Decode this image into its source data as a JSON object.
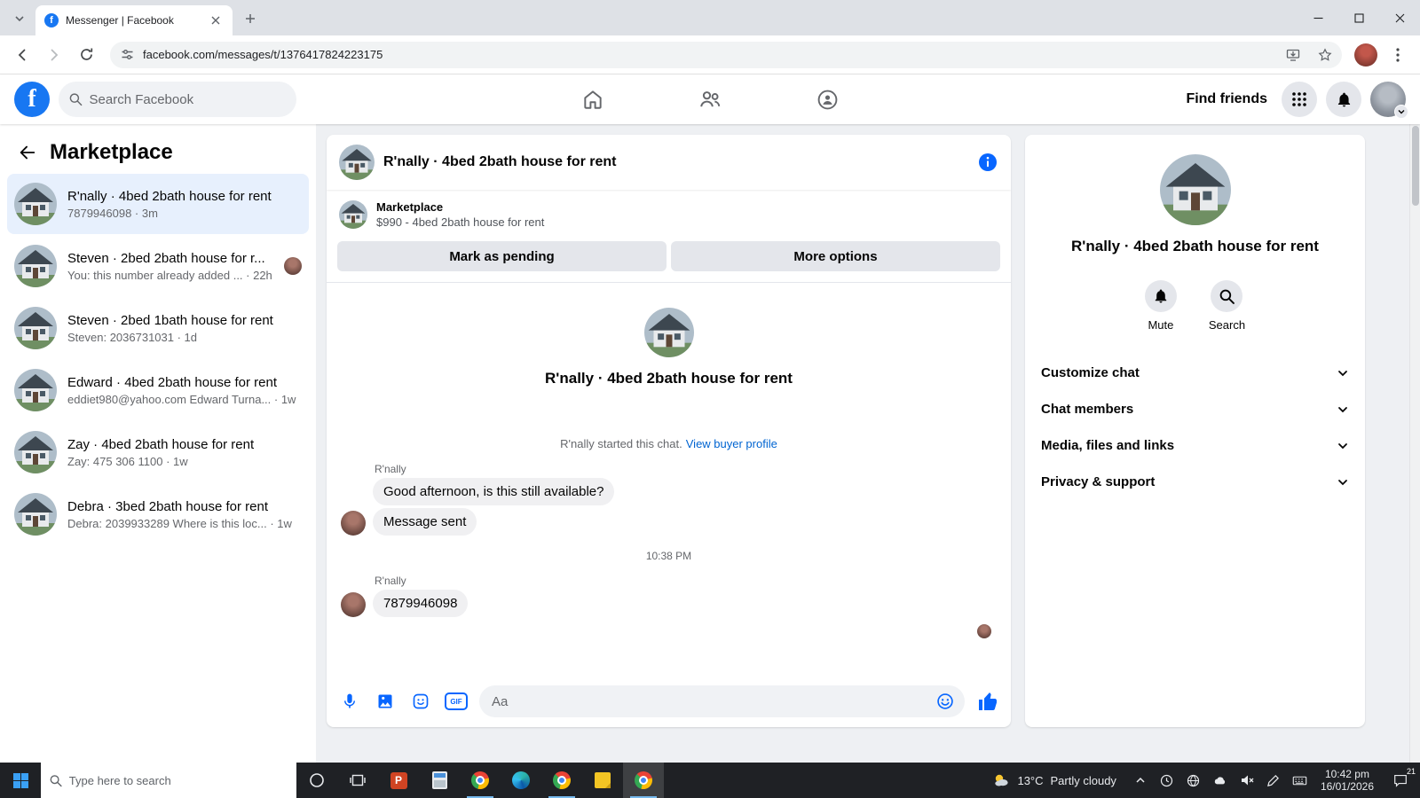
{
  "colors": {
    "facebook_blue": "#1877f2",
    "messenger_blue": "#0866ff",
    "link_blue": "#0064d1",
    "selected_conversation_bg": "#e7f0fd",
    "bubble_gray": "#f0f0f2",
    "taskbar_bg": "#1f2125"
  },
  "browser": {
    "tab_title": "Messenger | Facebook",
    "url": "facebook.com/messages/t/1376417824223175"
  },
  "fb_header": {
    "search_placeholder": "Search Facebook",
    "find_friends_label": "Find friends"
  },
  "sidebar": {
    "title": "Marketplace",
    "conversations": [
      {
        "title": "R'nally · 4bed 2bath house for rent",
        "snippet": "7879946098 · 3m"
      },
      {
        "title": "Steven · 2bed 2bath house for r...",
        "snippet": "You: this number already added ... · 22h"
      },
      {
        "title": "Steven · 2bed 1bath house for rent",
        "snippet": "Steven: 2036731031 · 1d"
      },
      {
        "title": "Edward · 4bed 2bath house for rent",
        "snippet": "eddiet980@yahoo.com Edward Turna... · 1w"
      },
      {
        "title": "Zay · 4bed 2bath house for rent",
        "snippet": "Zay: 475 306 1100 · 1w"
      },
      {
        "title": "Debra · 3bed 2bath house for rent",
        "snippet": "Debra: 2039933289 Where is this loc... · 1w"
      }
    ]
  },
  "chat": {
    "header_title": "R'nally · 4bed 2bath house for rent",
    "banner_label": "Marketplace",
    "banner_detail": "$990 - 4bed 2bath house for rent",
    "mark_pending_label": "Mark as pending",
    "more_options_label": "More options",
    "intro_title": "R'nally · 4bed 2bath house for rent",
    "started_text": "R'nally started this chat.",
    "view_profile_link": "View buyer profile",
    "sender_name": "R'nally",
    "message_1": "Good afternoon, is this still available?",
    "message_2": "Message sent",
    "timestamp": "10:38 PM",
    "message_3": "7879946098",
    "composer_placeholder": "Aa"
  },
  "details": {
    "title": "R'nally · 4bed 2bath house for rent",
    "mute_label": "Mute",
    "search_label": "Search",
    "sections": [
      {
        "label": "Customize chat"
      },
      {
        "label": "Chat members"
      },
      {
        "label": "Media, files and links"
      },
      {
        "label": "Privacy & support"
      }
    ]
  },
  "icons": {
    "facebook_f": "f",
    "gif_label": "GIF",
    "powerpoint_letter": "P"
  },
  "taskbar": {
    "search_placeholder": "Type here to search",
    "weather_temp": "13°C",
    "weather_condition": "Partly cloudy",
    "time": "10:42 pm",
    "date": "16/01/2026",
    "notification_count": "21"
  }
}
